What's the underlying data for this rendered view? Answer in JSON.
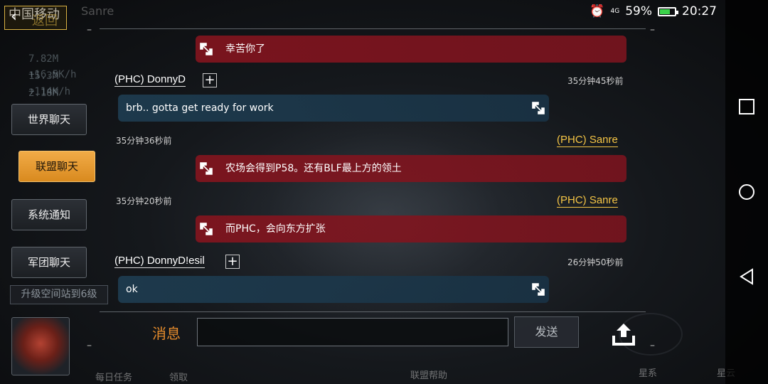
{
  "status_bar": {
    "carrier": "中国移动",
    "network": "4G",
    "battery": "59%",
    "time": "20:27"
  },
  "header": {
    "back_label": "返回",
    "player_name": "Sanre"
  },
  "background": {
    "resources": [
      "7.82M +16.5K/h",
      "15.3M +114K/h",
      "2.18M +8.92K/h"
    ]
  },
  "sidebar": {
    "tabs": [
      {
        "label": "世界聊天",
        "active": false
      },
      {
        "label": "联盟聊天",
        "active": true
      },
      {
        "label": "系统通知",
        "active": false
      },
      {
        "label": "军团聊天",
        "active": false
      }
    ],
    "upgrade_label": "升级空间站到6级"
  },
  "messages": [
    {
      "side": "own",
      "text": "幸苦你了"
    },
    {
      "side": "other",
      "sender": "(PHC) DonnyD",
      "time": "35分钟45秒前",
      "text": "brb.. gotta get ready for work"
    },
    {
      "side": "own",
      "sender": "(PHC) Sanre",
      "time": "35分钟36秒前",
      "text": "农场会得到P58。还有BLF最上方的领土"
    },
    {
      "side": "own",
      "sender": "(PHC) Sanre",
      "time": "35分钟20秒前",
      "text": "而PHC，会向东方扩张"
    },
    {
      "side": "other",
      "sender": "(PHC) DonnyD!esil",
      "time": "26分钟50秒前",
      "text": "ok"
    }
  ],
  "composer": {
    "label": "消息",
    "value": "",
    "send_label": "发送"
  },
  "game_nav": {
    "daily": "每日任务",
    "claim": "领取",
    "alliance_help": "联盟帮助",
    "galaxy": "星系",
    "nebula": "星云"
  },
  "colors": {
    "accent": "#e58b2c",
    "own_bubble": "#87141e",
    "other_bubble": "#1e3c50",
    "self_name": "#f5c545"
  }
}
